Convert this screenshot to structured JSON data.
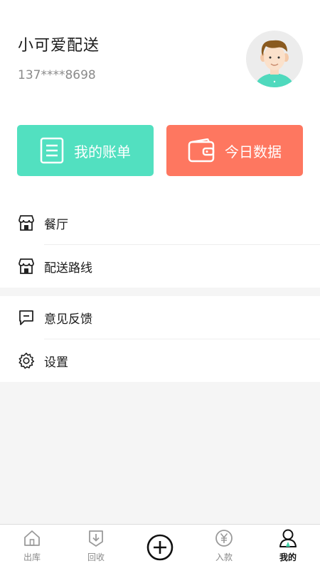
{
  "profile": {
    "name": "小可爱配送",
    "phone": "137****8698"
  },
  "actions": {
    "bill_label": "我的账单",
    "today_label": "今日数据",
    "bill_color": "#52e0c0",
    "today_color": "#fe7760"
  },
  "menu": {
    "restaurant": "餐厅",
    "route": "配送路线",
    "feedback": "意见反馈",
    "settings": "设置"
  },
  "tabs": [
    {
      "label": "出库",
      "icon": "house-icon"
    },
    {
      "label": "回收",
      "icon": "recycle-box-icon"
    },
    {
      "label": "",
      "icon": "plus-circle-icon"
    },
    {
      "label": "入款",
      "icon": "yen-coin-icon"
    },
    {
      "label": "我的",
      "icon": "person-icon",
      "active": true
    }
  ]
}
